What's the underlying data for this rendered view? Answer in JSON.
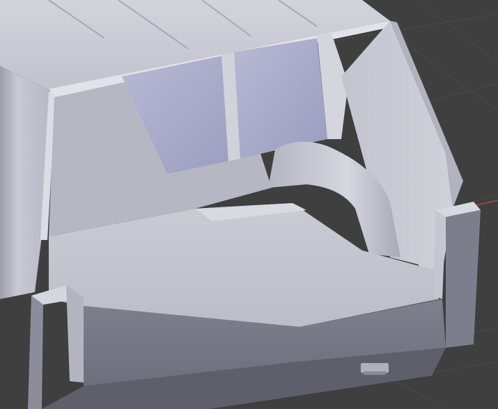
{
  "viewport": {
    "background_color": "#3f3f3f",
    "grid_color": "#4a4a4a",
    "axis_x_color": "#b04a4a"
  },
  "model": {
    "body_color": "#c8c8d0",
    "shadow_color": "#7a7a88",
    "glass_color": "#a8aac8",
    "floor_color": "#c4c4ce"
  }
}
